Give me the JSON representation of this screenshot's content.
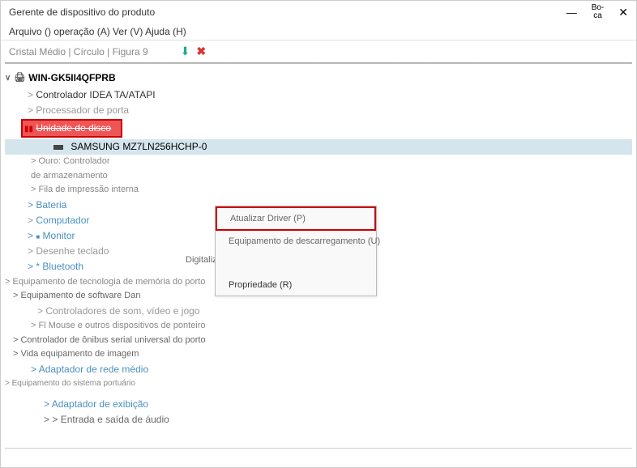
{
  "window": {
    "title": "Gerente de dispositivo do produto",
    "controls": {
      "minimize": "—",
      "maximize": "Bo-\nca",
      "close": "✕"
    }
  },
  "menubar": "Arquivo () operação (A) Ver (V) Ajuda (H)",
  "toolbar_text": "Cristal Médio | Círculo | Figura 9",
  "root": "WIN-GK5II4QFPRB",
  "nodes": {
    "controller": "Controlador IDEA TA/ATAPI",
    "port_processor": "Processador de porta",
    "disk_drive_highlight": "Unidade de disco",
    "samsung": "SAMSUNG MZ7LN256HCHP-0",
    "gold": "> Ouro: Controlador",
    "storage": "de armazenamento",
    "print_queue": "> Fila de impressão interna",
    "battery": "Bateria",
    "computer": "Computador",
    "monitor": "Monitor",
    "keyboard": "Desenhe teclado",
    "bluetooth": "* Bluetooth",
    "memory_eq": "Equipamento de tecnologia de memória do porto",
    "software_eq": "Equipamento de software Dan",
    "sound_ctrl": "Controladores de som, vídeo e jogo",
    "mouse": "> Fl Mouse e outros dispositivos de ponteiro",
    "usb_bus": "Controlador de ônibus serial universal do porto",
    "imaging": "Vida equipamento de imagem",
    "network": "Adaptador de rede médio",
    "system_eq": "Equipamento do sistema portuário",
    "display_adapter": "Adaptador de exibição",
    "audio_io": "Entrada e saída de áudio"
  },
  "context_menu": {
    "update_driver": "Atualizar Driver (P)",
    "uninstall": "Equipamento de descarregamento (U)",
    "scan": "Digitalize e detecte alterações de hardware (A)",
    "properties": "Propriedade (R)"
  }
}
